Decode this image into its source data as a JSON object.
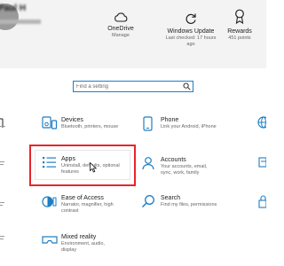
{
  "user": {
    "name": "Paul H"
  },
  "header_actions": [
    {
      "title": "OneDrive",
      "subtitle": "Manage",
      "icon": "cloud-icon"
    },
    {
      "title": "Windows Update",
      "subtitle": "Last checked: 17 hours ago",
      "icon": "refresh-icon"
    },
    {
      "title": "Rewards",
      "subtitle": "451 points",
      "icon": "trophy-icon"
    }
  ],
  "search": {
    "placeholder": "Find a setting"
  },
  "tiles": {
    "devices": {
      "title": "Devices",
      "subtitle": "Bluetooth, printers, mouse",
      "icon": "devices-icon"
    },
    "phone": {
      "title": "Phone",
      "subtitle": "Link your Android, iPhone",
      "icon": "phone-icon"
    },
    "apps": {
      "title": "Apps",
      "subtitle": "Uninstall, defaults, optional features",
      "icon": "apps-list-icon"
    },
    "accounts": {
      "title": "Accounts",
      "subtitle": "Your accounts, email, sync, work, family",
      "icon": "person-icon"
    },
    "ease_of_access": {
      "title": "Ease of Access",
      "subtitle": "Narrator, magnifier, high contrast",
      "icon": "ease-of-access-icon"
    },
    "search": {
      "title": "Search",
      "subtitle": "Find my files, permissions",
      "icon": "search-icon"
    },
    "mixed_reality": {
      "title": "Mixed reality",
      "subtitle": "Environment, audio, display",
      "icon": "mixed-reality-icon"
    }
  },
  "colors": {
    "accent": "#1f7ec4",
    "highlight": "#e8242a",
    "header_bg": "#f3f3f3"
  }
}
